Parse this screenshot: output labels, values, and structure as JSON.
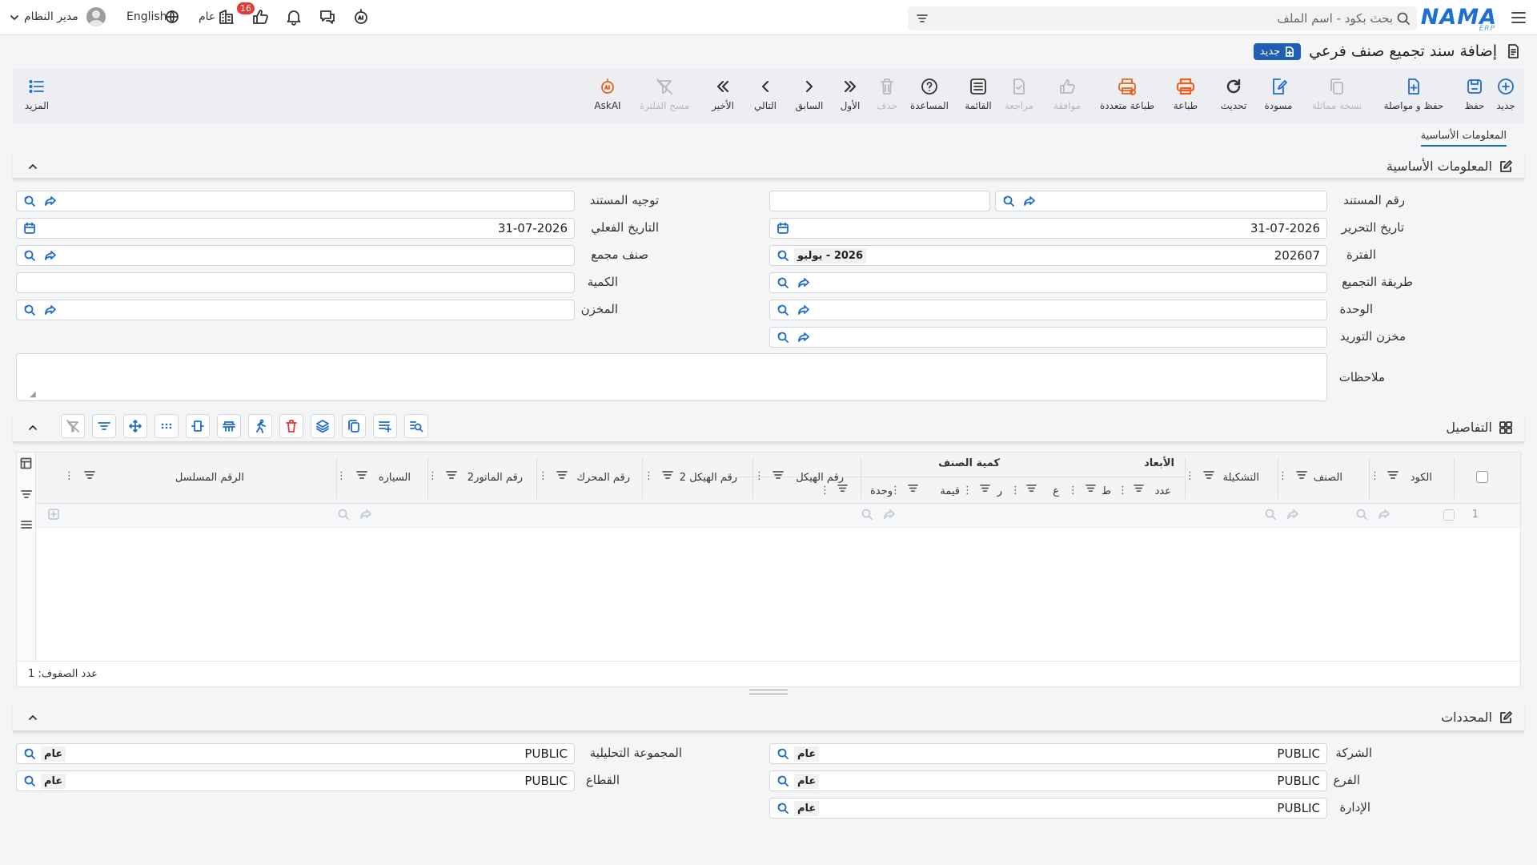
{
  "header": {
    "search_placeholder": "بحث بكود - اسم الملف",
    "logo": "NAMA",
    "logo_sub": "ERP",
    "notif_count": "16",
    "scope": "عام",
    "language": "English",
    "user": "مدير النظام"
  },
  "page": {
    "title": "إضافة سند تجميع صنف فرعي",
    "new_badge": "جديد"
  },
  "toolbar": {
    "new": "جديد",
    "save": "حفظ",
    "save_continue": "حفظ و مواصلة",
    "copy": "نسخة مماثلة",
    "draft": "مسودة",
    "refresh": "تحديث",
    "print": "طباعة",
    "multi_print": "طباعة متعددة",
    "approve": "موافقة",
    "review": "مراجعة",
    "list": "القائمة",
    "help": "المساعدة",
    "delete": "حذف",
    "first": "الأول",
    "prev": "السابق",
    "next": "التالي",
    "last": "الأخير",
    "clear_filter": "مسح الفلترة",
    "askai": "AskAI",
    "more": "المزيد"
  },
  "tabs": {
    "basic": "المعلومات الأساسية"
  },
  "basic": {
    "title": "المعلومات الأساسية",
    "doc_no_label": "رقم المستند",
    "doc_route_label": "توجيه المستند",
    "edit_date_label": "تاريخ التحرير",
    "edit_date": "31-07-2026",
    "actual_date_label": "التاريخ الفعلي",
    "actual_date": "31-07-2026",
    "period_label": "الفترة",
    "period_code": "202607",
    "period_name": "2026 - يوليو",
    "assembled_item_label": "صنف مجمع",
    "method_label": "طريقة التجميع",
    "qty_label": "الكمية",
    "unit_label": "الوحدة",
    "warehouse_label": "المخزن",
    "supply_wh_label": "مخزن التوريد",
    "notes_label": "ملاحظات"
  },
  "details": {
    "title": "التفاصيل",
    "columns": {
      "code": "الكود",
      "item": "الصنف",
      "config": "التشكيلة",
      "dims": "الأبعاد",
      "count": "عدد",
      "l": "ط",
      "w": "ع",
      "r": "ر",
      "item_qty": "كمية الصنف",
      "value": "قيمة",
      "unit": "وحدة",
      "chassis": "رقم الهيكل",
      "chassis2": "رقم الهيكل 2",
      "engine": "رقم المحرك",
      "motor2": "رقم الماتور2",
      "car": "السياره",
      "serial": "الرقم المسلسل"
    },
    "row_no": "1",
    "footer": "عدد الصفوف: 1"
  },
  "dimensions": {
    "title": "المحددات",
    "company_label": "الشركة",
    "company": "PUBLIC",
    "company_tag": "عام",
    "analytic_label": "المجموعة التحليلية",
    "analytic": "PUBLIC",
    "analytic_tag": "عام",
    "branch_label": "الفرع",
    "branch": "PUBLIC",
    "branch_tag": "عام",
    "sector_label": "القطاع",
    "sector": "PUBLIC",
    "sector_tag": "عام",
    "dept_label": "الإدارة",
    "dept": "PUBLIC",
    "dept_tag": "عام"
  }
}
